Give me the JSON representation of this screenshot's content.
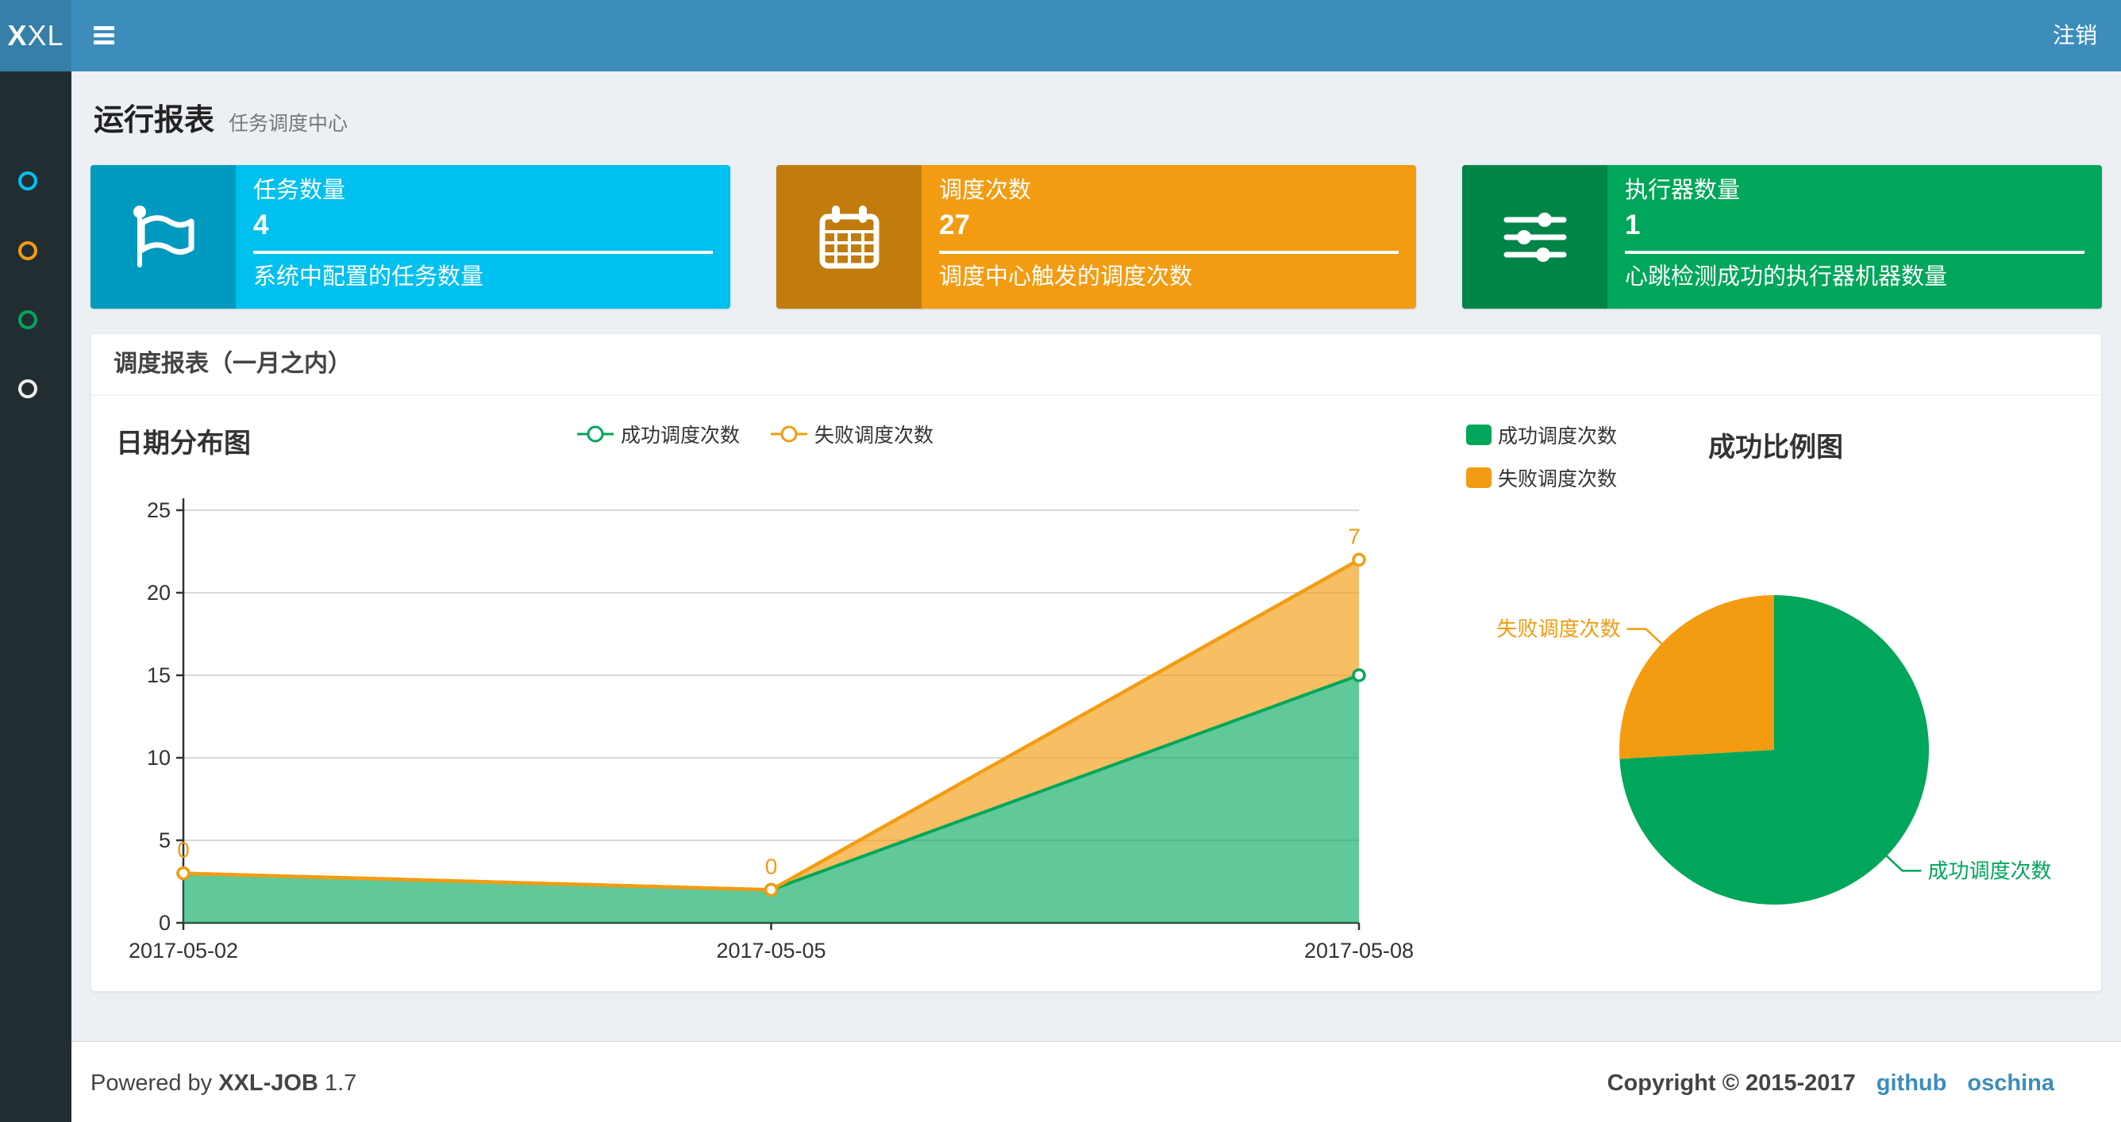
{
  "navbar": {
    "logo_bold": "X",
    "logo_rest": "XL",
    "logout_label": "注销"
  },
  "sidebar": {
    "items": [
      {
        "name": "sidebar-item-dashboard",
        "color": "#00c0ef"
      },
      {
        "name": "sidebar-item-job-manage",
        "color": "#f39c12"
      },
      {
        "name": "sidebar-item-job-log",
        "color": "#00a65a"
      },
      {
        "name": "sidebar-item-help",
        "color": "#eeeeee"
      }
    ]
  },
  "page_header": {
    "title": "运行报表",
    "subtitle": "任务调度中心"
  },
  "stat_boxes": [
    {
      "label": "任务数量",
      "value": "4",
      "desc": "系统中配置的任务数量",
      "color": "#00c0ef",
      "icon": "flag-icon"
    },
    {
      "label": "调度次数",
      "value": "27",
      "desc": "调度中心触发的调度次数",
      "color": "#f39c12",
      "icon": "calendar-icon"
    },
    {
      "label": "执行器数量",
      "value": "1",
      "desc": "心跳检测成功的执行器机器数量",
      "color": "#00a65a",
      "icon": "sliders-icon"
    }
  ],
  "panel_title": "调度报表（一月之内）",
  "chart_data": [
    {
      "type": "area",
      "title": "日期分布图",
      "x": [
        "2017-05-02",
        "2017-05-05",
        "2017-05-08"
      ],
      "series": [
        {
          "name": "成功调度次数",
          "color": "#00a65a",
          "values": [
            3,
            2,
            15
          ]
        },
        {
          "name": "失败调度次数",
          "color": "#f39c12",
          "values": [
            0,
            0,
            7
          ],
          "labels": [
            "0",
            "0",
            "7"
          ]
        }
      ],
      "stacked": true,
      "ylim": [
        0,
        25
      ],
      "yticks": [
        0,
        5,
        10,
        15,
        20,
        25
      ],
      "grid": true,
      "legend_position": "top-center"
    },
    {
      "type": "pie",
      "title": "成功比例图",
      "slices": [
        {
          "name": "成功调度次数",
          "value": 20,
          "color": "#00a65a"
        },
        {
          "name": "失败调度次数",
          "value": 7,
          "color": "#f39c12"
        }
      ],
      "legend_position": "top-left"
    }
  ],
  "footer": {
    "powered_prefix": "Powered by",
    "app_name": "XXL-JOB",
    "version": "1.7",
    "copyright": "Copyright © 2015-2017",
    "links": [
      "github",
      "oschina"
    ]
  },
  "colors": {
    "navbar": "#3c8dbc",
    "logo_bg": "#367fa9",
    "sidebar_bg": "#222d32",
    "content_bg": "#ecf0f5",
    "success": "#00a65a",
    "fail": "#f39c12",
    "info": "#00c0ef",
    "link": "#3c8dbc"
  }
}
